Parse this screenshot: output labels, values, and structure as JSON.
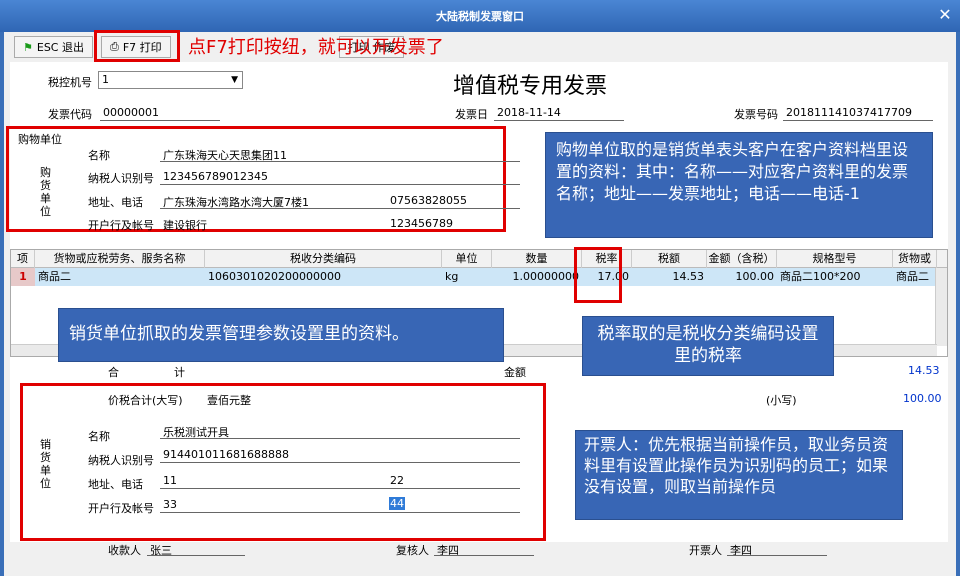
{
  "window": {
    "title": "大陆税制发票窗口",
    "close": "✕"
  },
  "toolbar": {
    "esc_label": "ESC 退出",
    "print_label": "F7 打印",
    "hidden_label": "打印 作废"
  },
  "annotation_top": "点F7打印按纽，就可以开发票了",
  "header": {
    "tax_machine_label": "税控机号",
    "tax_machine_value": "1",
    "title": "增值税专用发票",
    "code_label": "发票代码",
    "code_value": "00000001",
    "date_label": "发票日",
    "date_value": "2018-11-14",
    "number_label": "发票号码",
    "number_value": "201811141037417709"
  },
  "buyer": {
    "section": "购物单位",
    "side": "购 货 单 位",
    "name_label": "名称",
    "name_value": "广东珠海天心天思集团11",
    "tax_label": "纳税人识别号",
    "tax_value": "123456789012345",
    "addr_label": "地址、电话",
    "addr_value": "广东珠海水湾路水湾大厦7楼1",
    "phone_value": "07563828055",
    "bank_label": "开户行及帐号",
    "bank_value": "建设银行",
    "account_value": "123456789"
  },
  "callouts": {
    "buyer": "购物单位取的是销货单表头客户在客户资料档里设置的资料：其中：名称——对应客户资料里的发票名称；地址——发票地址；电话——电话-1",
    "seller": "销货单位抓取的发票管理参数设置里的资料。",
    "rate": "税率取的是税收分类编码设置里的税率",
    "drawer": "开票人：优先根据当前操作员，取业务员资料里有设置此操作员为识别码的员工；如果没有设置，则取当前操作员"
  },
  "table": {
    "headers": [
      "项",
      "货物或应税劳务、服务名称",
      "税收分类编码",
      "单位",
      "数量",
      "税率",
      "税额",
      "金额（含税）",
      "规格型号",
      "货物或应"
    ],
    "row": {
      "no": "1",
      "name": "商品二",
      "code": "1060301020200000000",
      "unit": "kg",
      "qty": "1.00000000",
      "rate": "17.00",
      "tax": "14.53",
      "amount": "100.00",
      "spec": "商品二100*200",
      "extra": "商品二"
    }
  },
  "totals": {
    "he_label": "合",
    "ji_label": "计",
    "amount_label": "金额",
    "tax_total": "14.53",
    "total_label": "价税合计(大写)",
    "total_upper": "壹佰元整",
    "small_label": "(小写)",
    "small_value": "100.00"
  },
  "seller": {
    "side": "销 货 单 位",
    "name_label": "名称",
    "name_value": "乐税测试开具",
    "tax_label": "纳税人识别号",
    "tax_value": "914401011681688888",
    "addr_label": "地址、电话",
    "addr_value": "11",
    "phone_value": "22",
    "bank_label": "开户行及帐号",
    "bank_value": "33",
    "account_value": "44"
  },
  "footer": {
    "payee_label": "收款人",
    "payee_value": "张三",
    "reviewer_label": "复核人",
    "reviewer_value": "李四",
    "drawer_label": "开票人",
    "drawer_value": "李四"
  }
}
